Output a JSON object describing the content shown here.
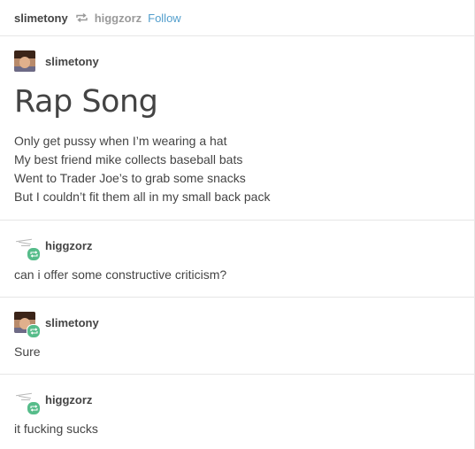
{
  "header": {
    "poster": "slimetony",
    "reblogged_from": "higgzorz",
    "follow_label": "Follow",
    "reblog_icon": "reblog-icon"
  },
  "post": {
    "author": "slimetony",
    "title": "Rap Song",
    "lines": [
      "Only get pussy when I’m wearing a hat",
      "My best friend mike collects baseball bats",
      "Went to Trader Joe’s to grab some snacks",
      "But I couldn’t fit them all in my small back pack"
    ]
  },
  "thread": [
    {
      "author": "higgzorz",
      "text": "can i offer some constructive criticism?"
    },
    {
      "author": "slimetony",
      "text": "Sure"
    },
    {
      "author": "higgzorz",
      "text": "it fucking sucks"
    }
  ],
  "colors": {
    "follow": "#529ecc",
    "reblog_badge": "#56bc8a",
    "divider": "#e6e6e6"
  }
}
